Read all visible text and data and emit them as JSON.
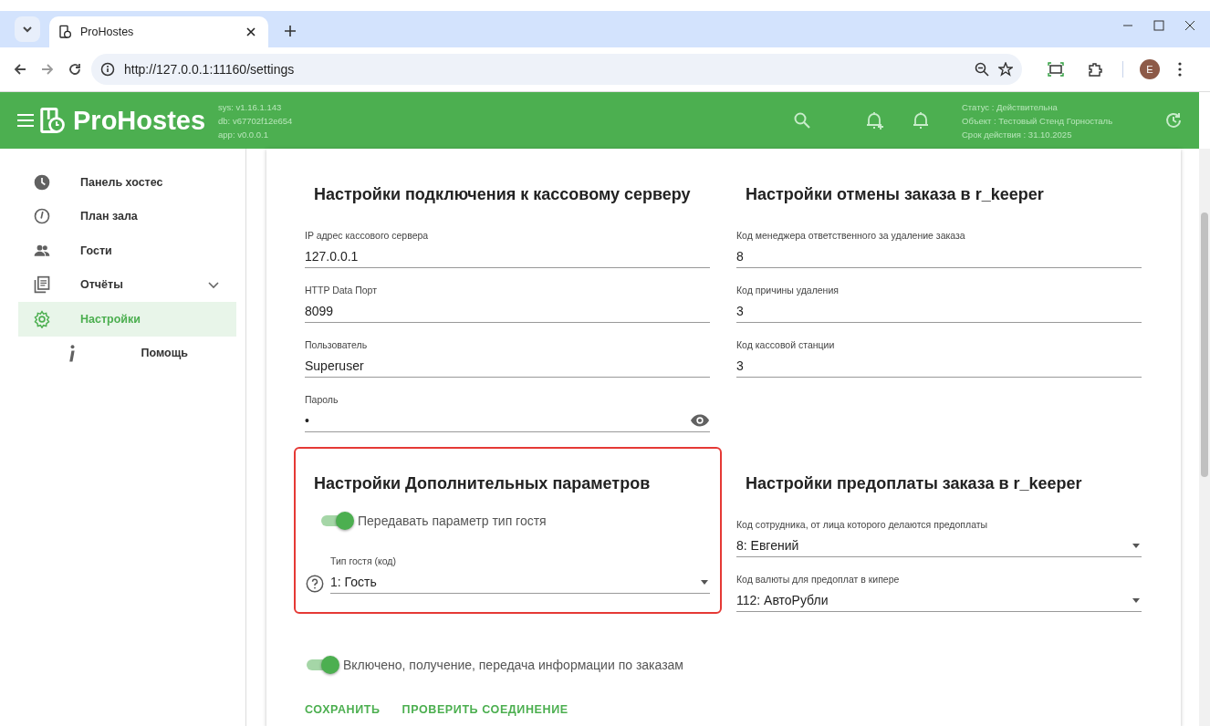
{
  "browser": {
    "tab_title": "ProHostes",
    "url": "http://127.0.0.1:11160/settings",
    "profile_initial": "E"
  },
  "app_bar": {
    "brand": "ProHostes",
    "versions": [
      "sys: v1.16.1.143",
      "db: v67702f12e654",
      "app: v0.0.0.1"
    ],
    "license": [
      "Статус : Действительна",
      "Объект : Тестовый Стенд Горносталь",
      "Срок действия : 31.10.2025"
    ]
  },
  "sidebar": {
    "items": [
      {
        "label": "Панель хостес",
        "selected": false
      },
      {
        "label": "План зала",
        "selected": false
      },
      {
        "label": "Гости",
        "selected": false
      },
      {
        "label": "Отчёты",
        "selected": false,
        "expanded": false
      },
      {
        "label": "Настройки",
        "selected": true
      },
      {
        "label": "Помощь",
        "selected": false
      }
    ]
  },
  "sections": [
    {
      "title": "Настройки подключения к кассовому серверу",
      "highlighted": false,
      "fields": [
        {
          "kind": "text",
          "label": "IP адрес кассового сервера",
          "value": "127.0.0.1"
        },
        {
          "kind": "text",
          "label": "HTTP Data Порт",
          "value": "8099"
        },
        {
          "kind": "text",
          "label": "Пользователь",
          "value": "Superuser"
        },
        {
          "kind": "password",
          "label": "Пароль",
          "value": "•"
        }
      ]
    },
    {
      "title": "Настройки отмены заказа в r_keeper",
      "highlighted": false,
      "fields": [
        {
          "kind": "text",
          "label": "Код менеджера ответственного за удаление заказа",
          "value": "8"
        },
        {
          "kind": "text",
          "label": "Код причины удаления",
          "value": "3"
        },
        {
          "kind": "text",
          "label": "Код кассовой станции",
          "value": "3"
        }
      ]
    },
    {
      "title": "Настройки Дополнительных параметров",
      "highlighted": true,
      "fields": [
        {
          "kind": "toggle",
          "label": "Передавать параметр тип гостя",
          "on": true
        },
        {
          "kind": "select",
          "label": "Тип гостя (код)",
          "value": "1: Гость",
          "help": true
        }
      ]
    },
    {
      "title": "Настройки предоплаты заказа в r_keeper",
      "highlighted": false,
      "fields": [
        {
          "kind": "select",
          "label": "Код сотрудника, от лица которого делаются предоплаты",
          "value": "8: Евгений",
          "help": false
        },
        {
          "kind": "select",
          "label": "Код валюты для предоплат в кипере",
          "value": "112: АвтоРубли",
          "help": false
        }
      ]
    }
  ],
  "orders_toggle": {
    "label": "Включено, получение, передача информации по заказам",
    "on": true
  },
  "actions": [
    "СОХРАНИТЬ",
    "ПРОВЕРИТЬ СОЕДИНЕНИЕ"
  ]
}
